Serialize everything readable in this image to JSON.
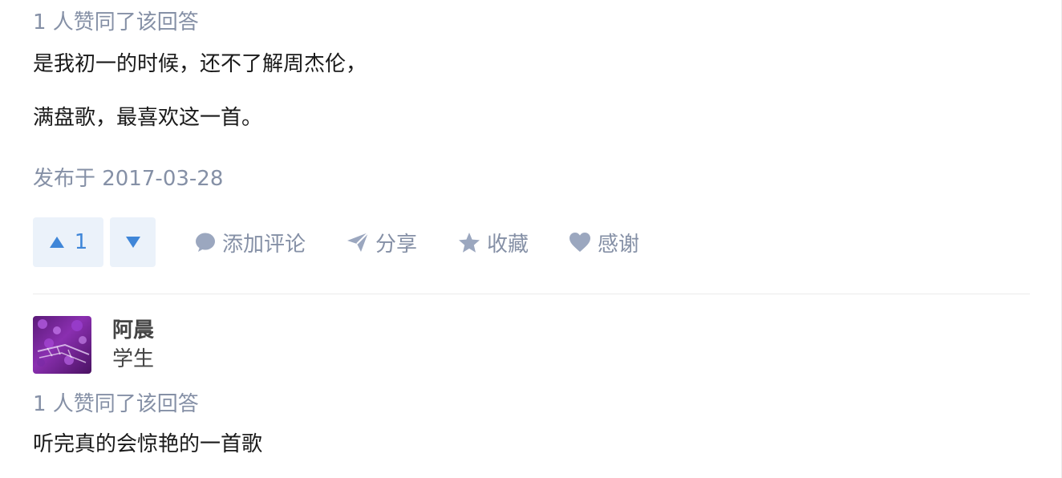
{
  "answer1": {
    "votes_line": "1 人赞同了该回答",
    "paragraphs": [
      "是我初一的时候，还不了解周杰伦，",
      "满盘歌，最喜欢这一首。"
    ],
    "published": "发布于 2017-03-28",
    "vote_up_count": "1",
    "actions": {
      "comment": {
        "label": "添加评论",
        "icon": "comment-icon"
      },
      "share": {
        "label": "分享",
        "icon": "paper-plane-icon"
      },
      "collect": {
        "label": "收藏",
        "icon": "star-icon"
      },
      "thanks": {
        "label": "感谢",
        "icon": "heart-icon"
      }
    }
  },
  "answer2": {
    "author": {
      "name": "阿晨",
      "title": "学生",
      "avatar": "purple-photo-avatar"
    },
    "votes_line": "1 人赞同了该回答",
    "paragraphs": [
      "听完真的会惊艳的一首歌"
    ]
  },
  "colors": {
    "meta_gray": "#8590a6",
    "text": "#1a1a1a",
    "vote_bg": "#ebf2fa",
    "vote_blue": "#3f86d8",
    "divider": "#ebebeb"
  }
}
